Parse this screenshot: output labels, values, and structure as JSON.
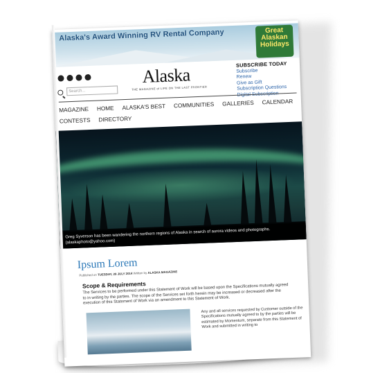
{
  "banner": {
    "title": "Alaska's Award Winning RV Rental Company",
    "promo_lines": [
      "Great",
      "Alaskan",
      "Holidays"
    ]
  },
  "header": {
    "social_icons": [
      "facebook-icon",
      "twitter-icon",
      "email-icon",
      "pinterest-icon"
    ],
    "search_placeholder": "Search...",
    "logo": "Alaska",
    "tagline": "THE MAGAZINE of LIFE ON THE LAST FRONTIER"
  },
  "subscribe": {
    "heading": "SUBSCRIBE TODAY",
    "links": [
      "Subscribe",
      "Renew",
      "Give as Gift",
      "Subscription Questions",
      "Digital Subscription"
    ]
  },
  "nav": {
    "row1": [
      "MAGAZINE",
      "HOME",
      "ALASKA'S BEST",
      "COMMUNITIES",
      "GALLERIES",
      "CALENDAR"
    ],
    "row2": [
      "CONTESTS",
      "DIRECTORY"
    ]
  },
  "photo": {
    "caption": "Greg Syverson has been wandering the northern regions of Alaska in search of aurora videos and photographs. (alaskaphoto@yahoo.com)"
  },
  "article": {
    "title": "Ipsum Lorem",
    "published_prefix": "Published on",
    "date": "TUESDAY, 29 JULY 2014",
    "written_by": "Written by",
    "author": "ALASKA MAGAZINE",
    "section": "Scope & Requirements",
    "body": "The Services to be performed under this Statement of Work will be based upon the Specifications mutually agreed to in writing by the parties. The scope of the Services set forth herein may be increased or decreased after the execution of this Statement of Work via an amendment to this Statement of Work.",
    "body2": "Any and all services requested by Customer outside of the Specifications mutually agreed to by the parties will be estimated by Momentum, separate from this Statement of Work and submitted in writing to"
  }
}
